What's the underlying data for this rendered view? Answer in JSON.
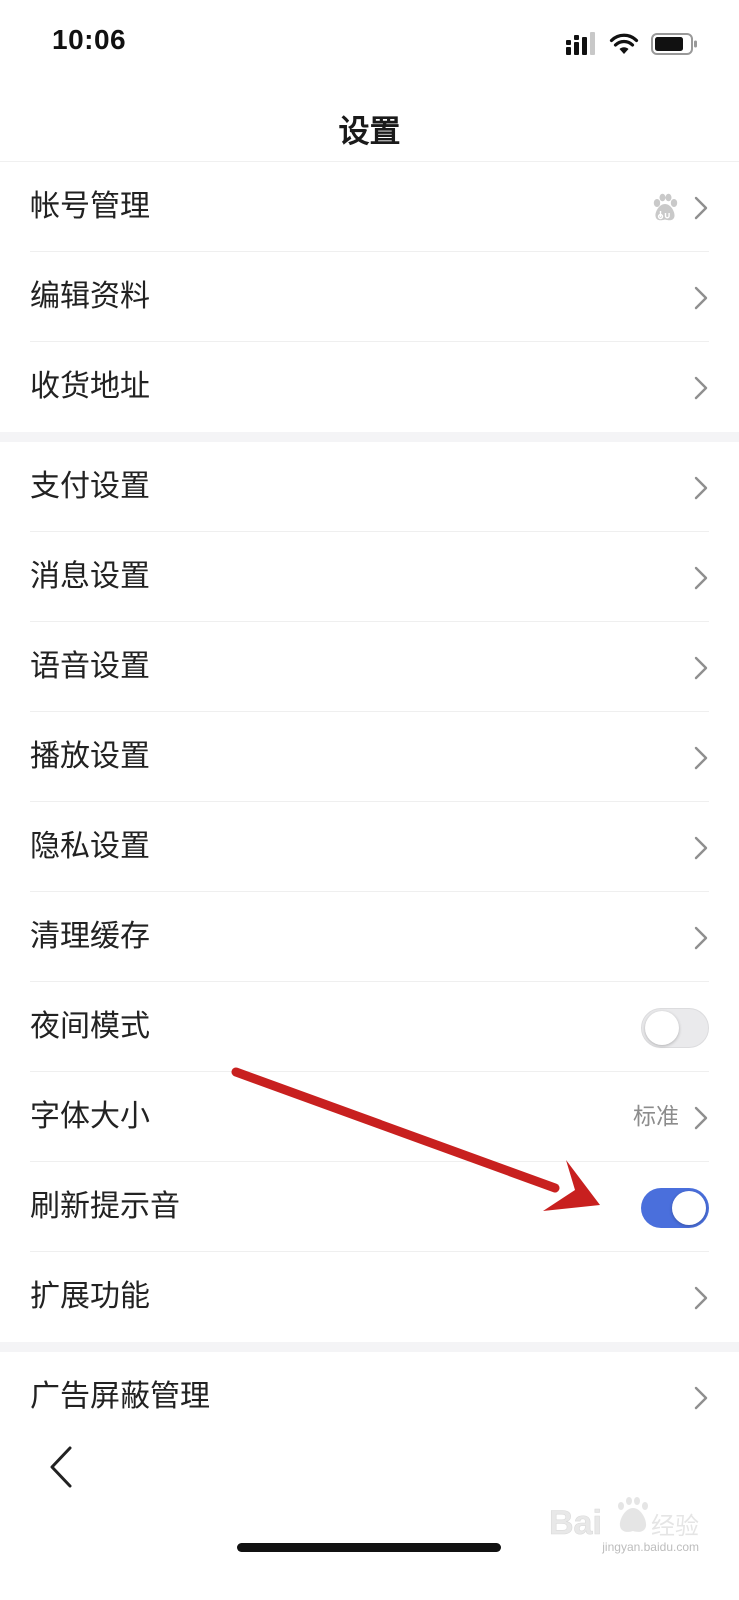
{
  "status_bar": {
    "time": "10:06"
  },
  "nav": {
    "title": "设置"
  },
  "groups": [
    {
      "items": [
        {
          "label": "帐号管理",
          "accessory": "chevron",
          "extra_icon": "baidu-paw-icon"
        },
        {
          "label": "编辑资料",
          "accessory": "chevron"
        },
        {
          "label": "收货地址",
          "accessory": "chevron"
        }
      ]
    },
    {
      "items": [
        {
          "label": "支付设置",
          "accessory": "chevron"
        },
        {
          "label": "消息设置",
          "accessory": "chevron"
        },
        {
          "label": "语音设置",
          "accessory": "chevron"
        },
        {
          "label": "播放设置",
          "accessory": "chevron"
        },
        {
          "label": "隐私设置",
          "accessory": "chevron"
        },
        {
          "label": "清理缓存",
          "accessory": "chevron"
        },
        {
          "label": "夜间模式",
          "accessory": "toggle",
          "toggle_on": false
        },
        {
          "label": "字体大小",
          "accessory": "chevron",
          "value": "标准"
        },
        {
          "label": "刷新提示音",
          "accessory": "toggle",
          "toggle_on": true
        },
        {
          "label": "扩展功能",
          "accessory": "chevron"
        }
      ]
    },
    {
      "items": [
        {
          "label": "广告屏蔽管理",
          "accessory": "chevron"
        }
      ]
    }
  ],
  "colors": {
    "accent": "#4a6fdc",
    "annotation_arrow": "#c8201f",
    "separator_band": "#f4f4f6"
  },
  "icons": {
    "back": "chevron-left-icon",
    "row_chevron": "chevron-right-icon",
    "account_badge": "baidu-paw-icon"
  },
  "watermark": {
    "brand": "Baidu经验",
    "site": "jingyan.baidu.com"
  }
}
